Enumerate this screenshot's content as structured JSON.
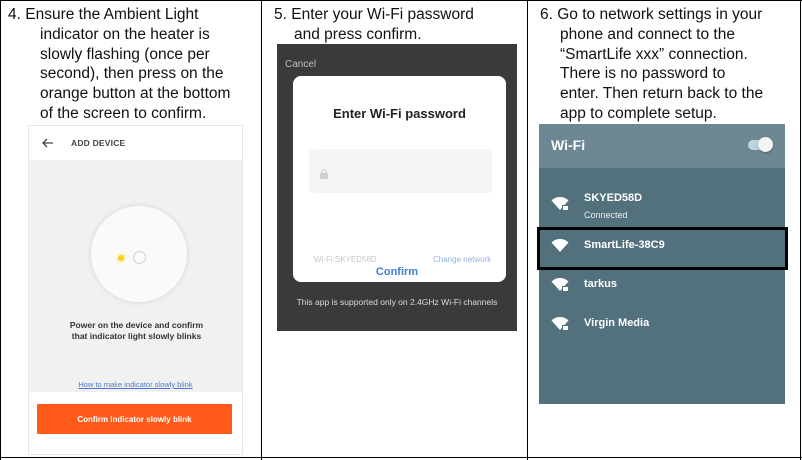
{
  "steps": [
    {
      "number": "4.",
      "lines": [
        "Ensure the Ambient Light",
        "indicator on the heater is",
        "slowly flashing (once per",
        "second), then press on the",
        "orange button at the bottom",
        "of the screen to confirm."
      ]
    },
    {
      "number": "5.",
      "lines": [
        "Enter your Wi-Fi password",
        "and press confirm."
      ]
    },
    {
      "number": "6.",
      "lines": [
        "Go to network settings in your",
        "phone and connect to the",
        "“SmartLife xxx” connection.",
        "There is no password to",
        "enter. Then return back to the",
        "app to complete setup."
      ]
    }
  ],
  "screen1": {
    "title": "ADD DEVICE",
    "instruction_line1": "Power on the device and confirm",
    "instruction_line2": "that indicator light slowly blinks",
    "help_link": "How to make indicator slowly blink",
    "confirm_button": "Confirm indicator slowly blink",
    "accent_color": "#ff5a1a",
    "indicator_color": "#f6d21d"
  },
  "screen2": {
    "cancel": "Cancel",
    "dialog_title": "Enter Wi-Fi password",
    "network_info": "Wi-Fi:SKYED58D",
    "change_network": "Change network",
    "confirm": "Confirm",
    "footnote": "This app is supported only on 2.4GHz Wi-Fi channels",
    "link_color": "#3d7ed6"
  },
  "screen3": {
    "title": "Wi-Fi",
    "toggle_on": true,
    "networks": [
      {
        "name": "SKYED58D",
        "status": "Connected",
        "icon": "wifi-icon",
        "highlighted": false
      },
      {
        "name": "SmartLife-38C9",
        "status": "",
        "icon": "wifi-icon",
        "highlighted": true
      },
      {
        "name": "tarkus",
        "status": "",
        "icon": "wifi-locked-icon",
        "highlighted": false
      },
      {
        "name": "Virgin Media",
        "status": "",
        "icon": "wifi-locked-icon",
        "highlighted": false
      }
    ],
    "background_color": "#53717d",
    "header_color": "#6e8893"
  }
}
